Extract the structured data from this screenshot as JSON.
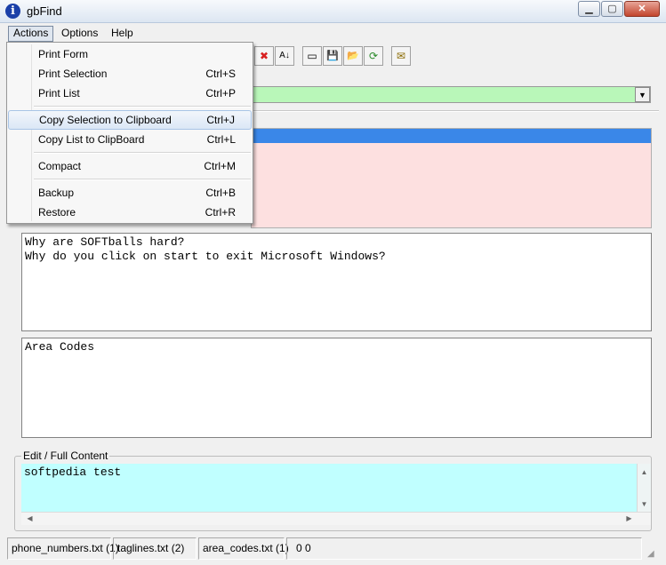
{
  "window": {
    "title": "gbFind",
    "app_icon_glyph": "i"
  },
  "menubar": {
    "items": [
      "Actions",
      "Options",
      "Help"
    ]
  },
  "toolbar": {
    "buttons": [
      {
        "name": "delete-icon",
        "glyph": "✖"
      },
      {
        "name": "sort-az-icon",
        "glyph": "A↓"
      },
      {
        "name": "blank-icon",
        "glyph": "▭"
      },
      {
        "name": "save-icon",
        "glyph": "💾"
      },
      {
        "name": "open-folder-icon",
        "glyph": "📂"
      },
      {
        "name": "refresh-icon",
        "glyph": "⟳"
      },
      {
        "name": "email-icon",
        "glyph": "✉"
      }
    ]
  },
  "main": {
    "textbox1_lines": "Why are SOFTballs hard?\nWhy do you click on start to exit Microsoft Windows?",
    "textbox2_text": "Area Codes",
    "edit_group_label": "Edit / Full Content",
    "edit_text": "softpedia test"
  },
  "status": {
    "panels": [
      "phone_numbers.txt  (1)",
      "taglines.txt  (2)",
      "area_codes.txt  (1)",
      "0   0"
    ]
  },
  "actions_menu": {
    "items": [
      {
        "label": "Print Form",
        "shortcut": ""
      },
      {
        "label": "Print Selection",
        "shortcut": "Ctrl+S"
      },
      {
        "label": "Print List",
        "shortcut": "Ctrl+P"
      },
      {
        "label": "Copy Selection to Clipboard",
        "shortcut": "Ctrl+J"
      },
      {
        "label": "Copy List to ClipBoard",
        "shortcut": "Ctrl+L"
      },
      {
        "label": "Compact",
        "shortcut": "Ctrl+M"
      },
      {
        "label": "Backup",
        "shortcut": "Ctrl+B"
      },
      {
        "label": "Restore",
        "shortcut": "Ctrl+R"
      }
    ]
  },
  "colors": {
    "combo_bg": "#b9f7b9",
    "list_bg": "#fde0e0",
    "selection": "#3a87e8",
    "edit_bg": "#c0ffff"
  }
}
